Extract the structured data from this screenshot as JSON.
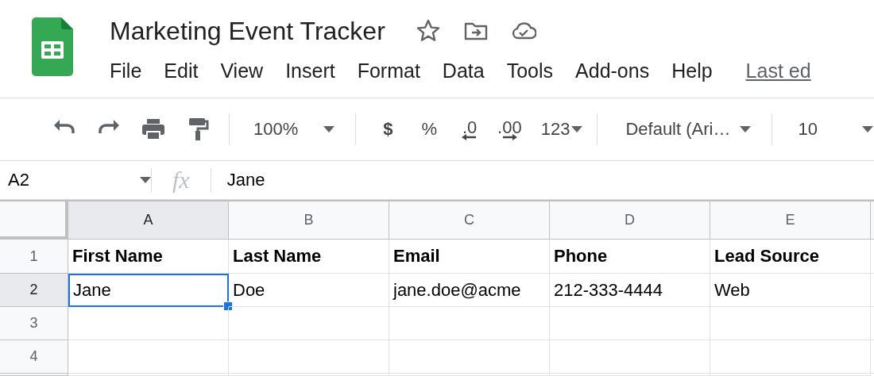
{
  "document": {
    "title": "Marketing Event Tracker"
  },
  "menu": [
    {
      "label": "File"
    },
    {
      "label": "Edit"
    },
    {
      "label": "View"
    },
    {
      "label": "Insert"
    },
    {
      "label": "Format"
    },
    {
      "label": "Data"
    },
    {
      "label": "Tools"
    },
    {
      "label": "Add-ons"
    },
    {
      "label": "Help"
    }
  ],
  "last_edit_link": "Last ed",
  "toolbar": {
    "zoom": "100%",
    "currency": "$",
    "percent": "%",
    "decrease_decimal": ".0",
    "increase_decimal": ".00",
    "more_formats": "123",
    "font": "Default (Ari…",
    "font_size": "10"
  },
  "formula_bar": {
    "name_box": "A2",
    "fx": "fx",
    "value": "Jane"
  },
  "sheet": {
    "columns": [
      {
        "label": "A",
        "selected": true
      },
      {
        "label": "B",
        "selected": false
      },
      {
        "label": "C",
        "selected": false
      },
      {
        "label": "D",
        "selected": false
      },
      {
        "label": "E",
        "selected": false
      }
    ],
    "rows": [
      {
        "label": "1",
        "selected": false,
        "cells": [
          {
            "text": "First Name",
            "bold": true,
            "selected": false
          },
          {
            "text": "Last Name",
            "bold": true,
            "selected": false
          },
          {
            "text": "Email",
            "bold": true,
            "selected": false
          },
          {
            "text": "Phone",
            "bold": true,
            "selected": false
          },
          {
            "text": "Lead Source",
            "bold": true,
            "selected": false
          }
        ]
      },
      {
        "label": "2",
        "selected": true,
        "cells": [
          {
            "text": "Jane",
            "bold": false,
            "selected": true
          },
          {
            "text": "Doe",
            "bold": false,
            "selected": false
          },
          {
            "text": "jane.doe@acme",
            "bold": false,
            "selected": false
          },
          {
            "text": "212-333-4444",
            "bold": false,
            "selected": false
          },
          {
            "text": "Web",
            "bold": false,
            "selected": false
          }
        ]
      },
      {
        "label": "3",
        "selected": false,
        "cells": [
          {
            "selected": false
          },
          {
            "selected": false
          },
          {
            "selected": false
          },
          {
            "selected": false
          },
          {
            "selected": false
          }
        ]
      },
      {
        "label": "4",
        "selected": false,
        "cells": [
          {
            "selected": false
          },
          {
            "selected": false
          },
          {
            "selected": false
          },
          {
            "selected": false
          },
          {
            "selected": false
          }
        ]
      }
    ]
  }
}
